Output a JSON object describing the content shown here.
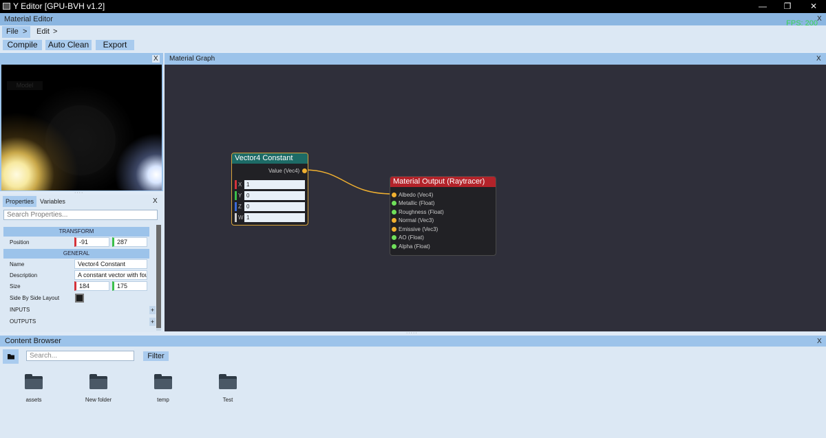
{
  "window": {
    "title": "Y Editor [GPU-BVH v1.2]"
  },
  "editor": {
    "title": "Material Editor",
    "fps": "FPS: 200"
  },
  "menu": {
    "file": "File",
    "edit": "Edit",
    "arrow": ">"
  },
  "toolbar": {
    "compile": "Compile",
    "auto_clean": "Auto Clean",
    "export": "Export"
  },
  "preview": {
    "model_label": "Model"
  },
  "properties": {
    "tab_properties": "Properties",
    "tab_variables": "Variables",
    "search_placeholder": "Search Properties...",
    "transform_header": "TRANSFORM",
    "general_header": "GENERAL",
    "position_label": "Position",
    "position_x": "-91",
    "position_y": "287",
    "name_label": "Name",
    "name_value": "Vector4 Constant",
    "description_label": "Description",
    "description_value": "A constant vector with four c",
    "size_label": "Size",
    "size_w": "184",
    "size_h": "175",
    "side_by_side_label": "Side By Side Layout",
    "inputs_label": "INPUTS",
    "outputs_label": "OUTPUTS",
    "plus": "+"
  },
  "graph": {
    "title": "Material Graph",
    "vec4_node": {
      "title": "Vector4 Constant",
      "output": "Value (Vec4)",
      "fields": [
        {
          "axis": "X",
          "value": "1"
        },
        {
          "axis": "Y",
          "value": "0"
        },
        {
          "axis": "Z",
          "value": "0"
        },
        {
          "axis": "W",
          "value": "1"
        }
      ]
    },
    "output_node": {
      "title": "Material Output (Raytracer)",
      "inputs": [
        "Albedo (Vec4)",
        "Metallic (Float)",
        "Roughness (Float)",
        "Normal (Vec3)",
        "Emissive (Vec3)",
        "AO (Float)",
        "Alpha (Float)"
      ]
    }
  },
  "content_browser": {
    "title": "Content Browser",
    "search_placeholder": "Search...",
    "filter": "Filter",
    "folders": [
      "assets",
      "New folder",
      "temp",
      "Test"
    ]
  },
  "colors": {
    "vec4_header": "#1d6b66",
    "output_header": "#b3232a",
    "pin_orange": "#f0b030",
    "pin_green": "#6fe05a",
    "connection": "#f0b030",
    "selection": "#d9a53a"
  },
  "icons": {
    "close": "X",
    "plus": "+"
  }
}
